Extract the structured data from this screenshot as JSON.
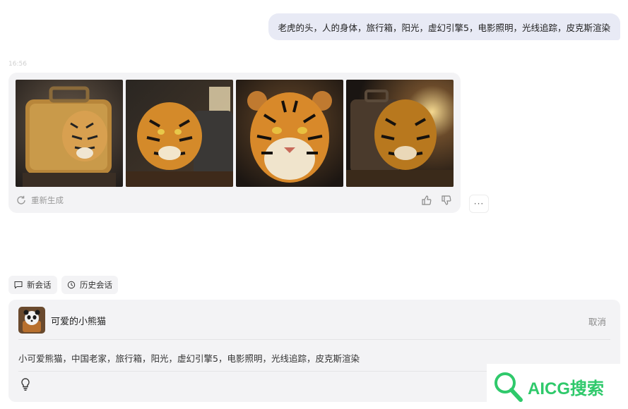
{
  "conversation": {
    "user_message": "老虎的头，人的身体，旅行箱，阳光，虚幻引擎5，电影照明，光线追踪，皮克斯渲染",
    "timestamp": "16:56",
    "reply": {
      "image_count": 4,
      "regenerate_label": "重新生成",
      "like_icon": "thumbs-up-icon",
      "dislike_icon": "thumbs-down-icon"
    },
    "more_label": "···"
  },
  "toolbar": {
    "new_chat_label": "新会话",
    "history_label": "历史会话"
  },
  "composer": {
    "agent_name": "可爱的小熊猫",
    "cancel_label": "取消",
    "prompt_text": "小可爱熊猫，中国老家，旅行箱，阳光，虚幻引擎5，电影照明，光线追踪，皮克斯渲染",
    "bulb_icon": "lightbulb-icon"
  },
  "watermark": {
    "text": "AICG搜索"
  },
  "colors": {
    "user_bubble": "#e8eaf5",
    "card_bg": "#f3f3f5",
    "watermark_green": "#2fc96b"
  }
}
